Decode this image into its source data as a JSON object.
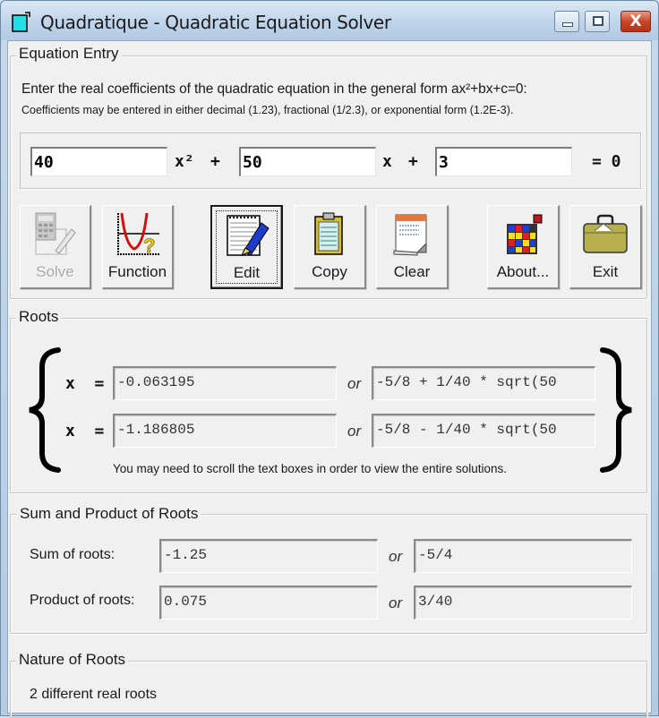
{
  "window": {
    "title": "Quadratique - Quadratic Equation Solver",
    "controls": {
      "minimize": "minimize",
      "maximize": "maximize",
      "close": "X"
    }
  },
  "equation_entry": {
    "group_title": "Equation Entry",
    "instruction": "Enter the real coefficients of the quadratic equation in the general form ax²+bx+c=0:",
    "hint": "Coefficients may be entered in either decimal (1.23), fractional (1/2.3), or exponential form (1.2E-3).",
    "a": "40",
    "b": "50",
    "c": "3",
    "term_x2": "x²",
    "plus1": "+",
    "term_x": "x",
    "plus2": "+",
    "equals": "= 0"
  },
  "toolbar": {
    "buttons": [
      {
        "label": "Solve",
        "icon": "calculator-pen-icon",
        "enabled": false
      },
      {
        "label": "Function",
        "icon": "parabola-graph-icon",
        "enabled": true
      },
      {
        "label": "Edit",
        "icon": "notepad-pen-icon",
        "enabled": true,
        "default": true
      },
      {
        "label": "Copy",
        "icon": "clipboard-icon",
        "enabled": true
      },
      {
        "label": "Clear",
        "icon": "notepad-peel-icon",
        "enabled": true
      },
      {
        "label": "About...",
        "icon": "colored-grid-icon",
        "enabled": true
      },
      {
        "label": "Exit",
        "icon": "briefcase-icon",
        "enabled": true
      }
    ]
  },
  "roots": {
    "group_title": "Roots",
    "x_label": "x  =",
    "or": "or",
    "root1_decimal": "-0.063195",
    "root1_exact": "-5/8 + 1/40 * sqrt(50",
    "root2_decimal": "-1.186805",
    "root2_exact": "-5/8 - 1/40 * sqrt(50",
    "note": "You may need to scroll the text boxes in order to view the entire solutions."
  },
  "sum_product": {
    "group_title": "Sum and Product of Roots",
    "sum_label": "Sum of roots:",
    "sum_decimal": "-1.25",
    "sum_exact": "-5/4",
    "product_label": "Product of roots:",
    "product_decimal": "0.075",
    "product_exact": "3/40",
    "or": "or"
  },
  "nature": {
    "group_title": "Nature of Roots",
    "text": "2 different real roots"
  }
}
